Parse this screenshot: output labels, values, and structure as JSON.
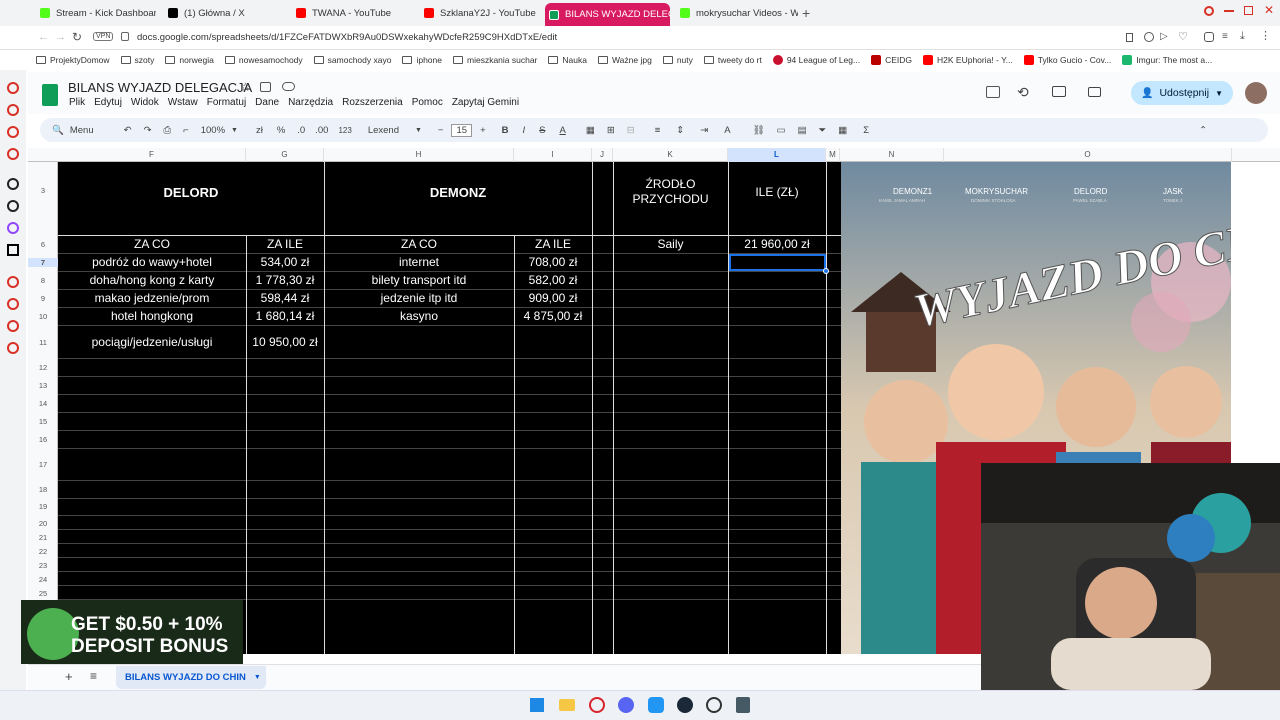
{
  "browser": {
    "tabs": [
      {
        "label": "Stream - Kick Dashboard",
        "color": "#53fc18"
      },
      {
        "label": "(1) Główna / X",
        "color": "#000000"
      },
      {
        "label": "TWANA - YouTube",
        "color": "#ff0000"
      },
      {
        "label": "SzklanaY2J - YouTube",
        "color": "#ff0000"
      },
      {
        "label": "BILANS WYJAZD DELEGA",
        "color": "#0f9d58"
      },
      {
        "label": "mokrysuchar Videos - Wa",
        "color": "#53fc18"
      }
    ],
    "vpn_label": "VPN",
    "url": "docs.google.com/spreadsheets/d/1FZCeFATDWXbR9Au0DSWxekahyWDcfeR259C9HXdDTxE/edit",
    "bookmarks": [
      "ProjektyDomow",
      "szoty",
      "norwegia",
      "nowesamochody",
      "samochody xayo",
      "iphone",
      "mieszkania suchar",
      "Nauka",
      "Ważne jpg",
      "nuty",
      "tweety do rt",
      "94 League of Leg...",
      "CEIDG",
      "H2K EUphoria! - Y...",
      "Tylko Gucio - Cov...",
      "Imgur: The most a..."
    ]
  },
  "sheets": {
    "title": "BILANS WYJAZD DELEGACJA",
    "menu": [
      "Plik",
      "Edytuj",
      "Widok",
      "Wstaw",
      "Formatuj",
      "Dane",
      "Narzędzia",
      "Rozszerzenia",
      "Pomoc",
      "Zapytaj Gemini"
    ],
    "share_label": "Udostępnij",
    "toolbar": {
      "menu_label": "Menu",
      "zoom": "100%",
      "currency": "zł",
      "percent": "%",
      "dec_less": ".0",
      "dec_more": ".00",
      "format": "123",
      "font": "Lexend",
      "font_size": "15"
    },
    "columns": [
      "F",
      "G",
      "H",
      "I",
      "J",
      "K",
      "L",
      "M",
      "N",
      "O"
    ],
    "rows": [
      "3",
      "6",
      "7",
      "8",
      "9",
      "10",
      "11",
      "12",
      "13",
      "14",
      "15",
      "16",
      "17",
      "18",
      "19",
      "20",
      "21",
      "22",
      "23",
      "24",
      "25"
    ],
    "headers": {
      "delord": "DELORD",
      "demonz": "DEMONZ",
      "source": "ŹRODŁO PRZYCHODU",
      "amount": "ILE (ZŁ)",
      "za_co": "ZA CO",
      "za_ile": "ZA ILE"
    },
    "delord_items": [
      {
        "what": "podróż do wawy+hotel",
        "cost": "534,00 zł"
      },
      {
        "what": "doha/hong kong z karty",
        "cost": "1 778,30 zł"
      },
      {
        "what": "makao jedzenie/prom",
        "cost": "598,44 zł"
      },
      {
        "what": "hotel hongkong",
        "cost": "1 680,14 zł"
      },
      {
        "what": "pociągi/jedzenie/usługi",
        "cost": "10 950,00 zł"
      }
    ],
    "demonz_items": [
      {
        "what": "internet",
        "cost": "708,00 zł"
      },
      {
        "what": "bilety transport itd",
        "cost": "582,00 zł"
      },
      {
        "what": "jedzenie itp itd",
        "cost": "909,00 zł"
      },
      {
        "what": "kasyno",
        "cost": "4 875,00 zł"
      }
    ],
    "income": {
      "source": "Saily",
      "amount": "21 960,00 zł"
    },
    "sheet_tab": "BILANS WYJAZD DO CHIN"
  },
  "poster": {
    "names": [
      {
        "nick": "DEMONZ1",
        "full": "KAMIL JAMAL AMRAH"
      },
      {
        "nick": "MOKRYSUCHAR",
        "full": "DOMINIK STOKŁOSA"
      },
      {
        "nick": "DELORD",
        "full": "PAWEŁ SZABLA"
      },
      {
        "nick": "JASK",
        "full": "TOMEK J"
      }
    ],
    "title": "WYJAZD DO CHIN"
  },
  "ad": {
    "line1": "GET $0.50 + 10%",
    "line2": "DEPOSIT BONUS"
  }
}
